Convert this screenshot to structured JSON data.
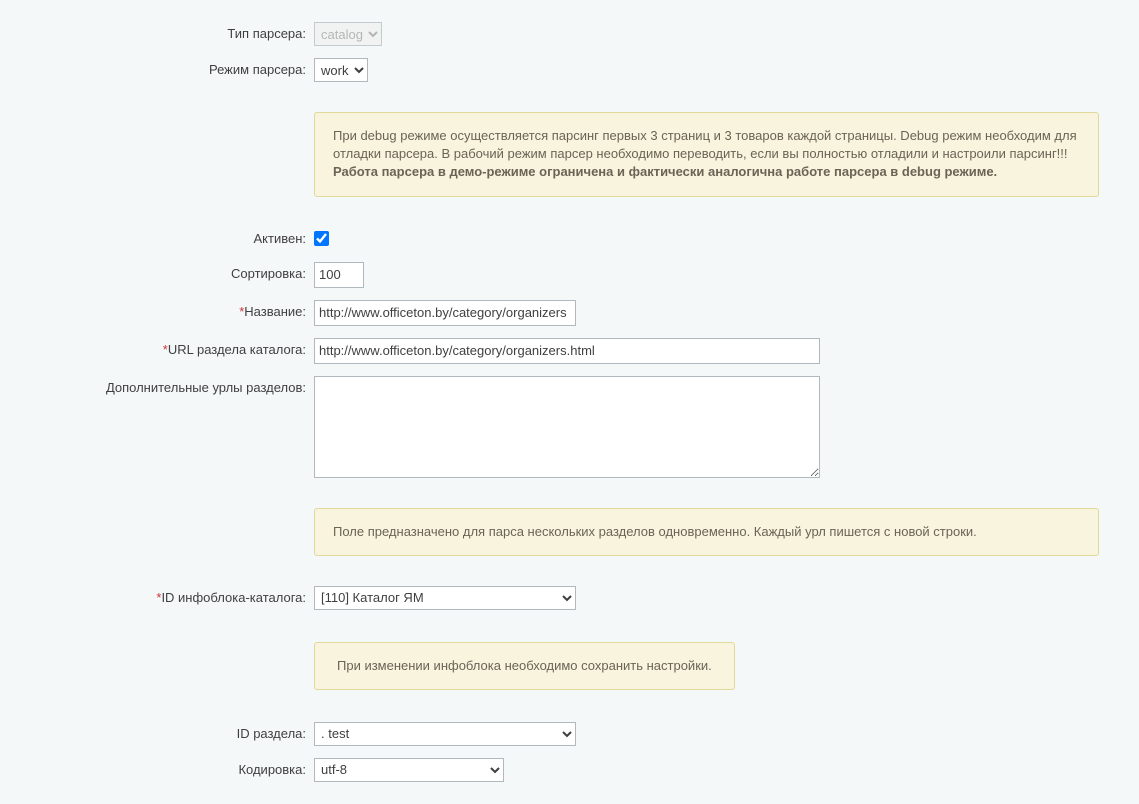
{
  "labels": {
    "parser_type": "Тип парсера:",
    "parser_mode": "Режим парсера:",
    "active": "Активен:",
    "sort": "Сортировка:",
    "name": "Название:",
    "url_section": "URL раздела каталога:",
    "additional_urls": "Дополнительные урлы разделов:",
    "iblock_id": "ID инфоблока-каталога:",
    "section_id": "ID раздела:",
    "encoding": "Кодировка:"
  },
  "values": {
    "parser_type": "catalog",
    "parser_mode": "work",
    "active_checked": true,
    "sort": "100",
    "name": "http://www.officeton.by/category/organizers",
    "url_section": "http://www.officeton.by/category/organizers.html",
    "additional_urls": "",
    "iblock_id": "[110] Каталог ЯМ",
    "section_id": ". test",
    "encoding": "utf-8"
  },
  "notes": {
    "debug_line1": "При debug режиме осуществляется парсинг первых 3 страниц и 3 товаров каждой страницы. Debug режим необходим для отладки парсера. В рабочий режим парсер необходимо переводить, если вы полностью отладили и настроили парсинг!!!",
    "debug_bold": "Работа парсера в демо-режиме ограничена и фактически аналогична работе парсера в debug режиме.",
    "additional_urls_note": "Поле предназначено для парса нескольких разделов одновременно. Каждый урл пишется с новой строки.",
    "iblock_note": "При изменении инфоблока необходимо сохранить настройки."
  }
}
